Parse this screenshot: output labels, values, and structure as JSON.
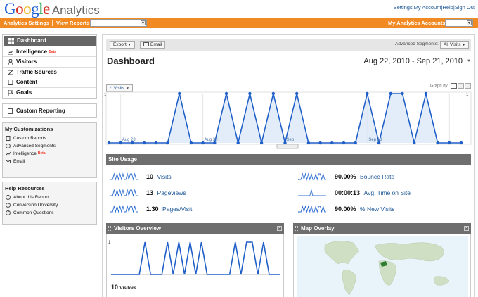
{
  "header": {
    "logo_google": "Google",
    "logo_analytics": "Analytics",
    "links": [
      "Settings",
      "My Account",
      "Help",
      "Sign Out"
    ]
  },
  "orangebar": {
    "settings_label": "Analytics Settings",
    "view_reports_label": "View Reports:",
    "my_accounts_label": "My Analytics Accounts:"
  },
  "sidebar": {
    "nav": [
      {
        "label": "Dashboard",
        "icon": "dashboard-icon",
        "active": true
      },
      {
        "label": "Intelligence",
        "beta": "Beta",
        "icon": "intelligence-icon"
      },
      {
        "label": "Visitors",
        "icon": "visitors-icon"
      },
      {
        "label": "Traffic Sources",
        "icon": "traffic-sources-icon"
      },
      {
        "label": "Content",
        "icon": "content-icon"
      },
      {
        "label": "Goals",
        "icon": "goals-icon"
      }
    ],
    "custom_reporting": "Custom Reporting",
    "customizations": {
      "title": "My Customizations",
      "items": [
        "Custom Reports",
        "Advanced Segments",
        "Intelligence",
        "Email"
      ],
      "intelligence_beta": "Beta"
    },
    "help": {
      "title": "Help Resources",
      "items": [
        "About this Report",
        "Conversion University",
        "Common Questions"
      ]
    }
  },
  "toolbar": {
    "export_label": "Export",
    "email_label": "Email",
    "adv_segments_label": "Advanced Segments:",
    "adv_segments_value": "All Visits"
  },
  "page": {
    "title": "Dashboard",
    "date_range": "Aug 22, 2010 - Sep 21, 2010"
  },
  "graph": {
    "metric_label": "Visits",
    "graph_by_label": "Graph by:",
    "y_max_label": "1",
    "x_labels": [
      "Aug 23",
      "Aug 30",
      "Sep",
      "Sep 13"
    ]
  },
  "chart_data": {
    "type": "area",
    "series": [
      {
        "name": "Visits",
        "values": [
          0,
          0,
          0,
          0,
          0,
          0,
          1,
          0,
          0,
          0,
          1,
          0,
          1,
          0,
          1,
          0,
          1,
          0,
          0,
          0,
          0,
          0,
          1,
          0,
          1,
          1,
          0,
          1,
          0,
          0,
          0
        ]
      }
    ],
    "ylim": [
      0,
      1
    ],
    "x_tick_labels": [
      "Aug 23",
      "Aug 30",
      "Sep",
      "Sep 13"
    ],
    "y_tick_labels": [
      "1",
      "1"
    ],
    "grid": true
  },
  "site_usage": {
    "title": "Site Usage",
    "metrics": [
      {
        "value": "10",
        "label": "Visits"
      },
      {
        "value": "13",
        "label": "Pageviews"
      },
      {
        "value": "1.30",
        "label": "Pages/Visit"
      },
      {
        "value": "90.00%",
        "label": "Bounce Rate"
      },
      {
        "value": "00:00:13",
        "label": "Avg. Time on Site"
      },
      {
        "value": "90.00%",
        "label": "% New Visits"
      }
    ]
  },
  "visitors_overview": {
    "title": "Visitors Overview",
    "y_label": "1",
    "count": "10",
    "count_label": "Visitors"
  },
  "map_overlay": {
    "title": "Map Overlay"
  },
  "colors": {
    "orange_bar": "#f28a23",
    "line_blue": "#1f5fc7",
    "area_fill": "#dce9f7",
    "section_header": "#6e6e6e"
  }
}
